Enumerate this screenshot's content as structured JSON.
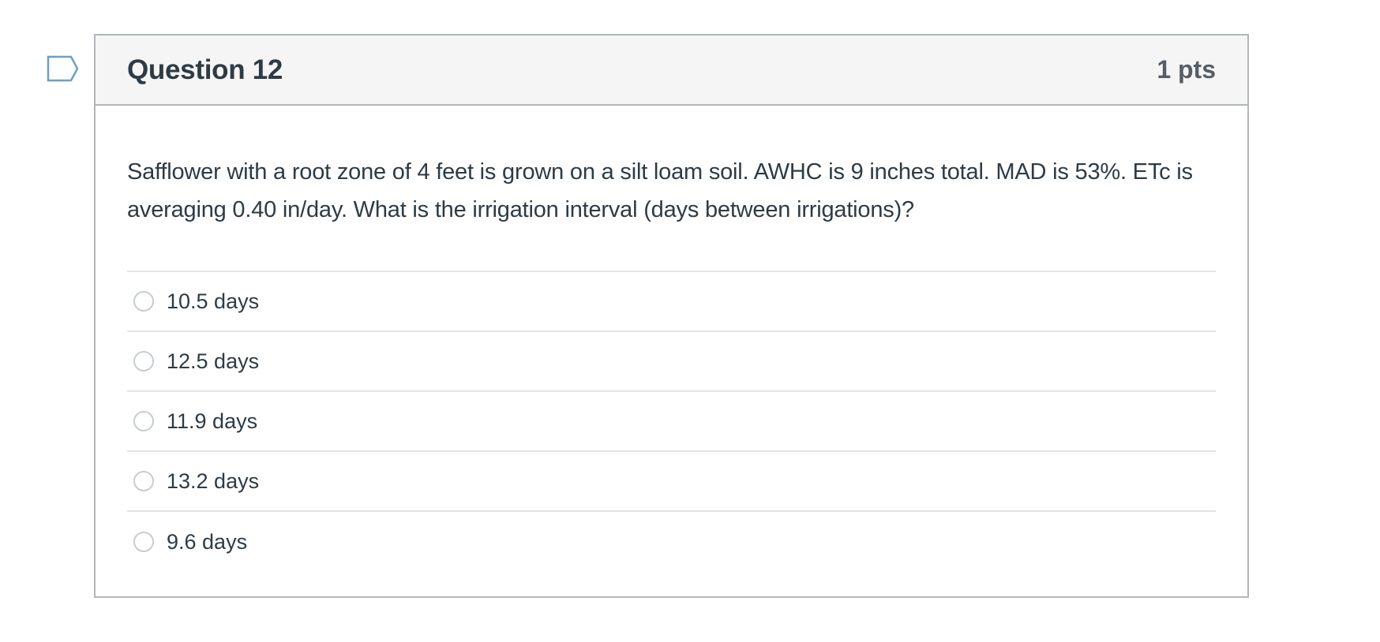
{
  "question": {
    "title": "Question 12",
    "points": "1 pts",
    "text": "Safflower with a root zone of 4 feet is grown on a silt loam soil.  AWHC is 9 inches total.  MAD is 53%.  ETc is averaging 0.40 in/day.  What is the irrigation interval (days between irrigations)?",
    "answers": [
      {
        "label": "10.5 days"
      },
      {
        "label": "12.5 days"
      },
      {
        "label": "11.9 days"
      },
      {
        "label": "13.2 days"
      },
      {
        "label": "9.6 days"
      }
    ]
  },
  "flag_icon": "bookmark-flag-icon",
  "colors": {
    "text": "#2d3b45",
    "border": "#b2b7bb",
    "header_bg": "#f5f5f5",
    "flag": "#6e9ec6"
  }
}
